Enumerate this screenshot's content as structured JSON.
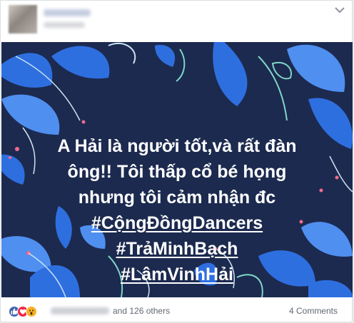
{
  "post": {
    "caption_lines": [
      "A Hải là người tốt,và rất đàn",
      "ông!! Tôi thấp cổ bé họng",
      "nhưng tôi cảm nhận đc"
    ],
    "hashtags": [
      "#CộngĐồngDancers",
      "#TrảMinhBạch",
      "#LâmVinhHải"
    ],
    "banner_colors": {
      "background": "#1c2a4f",
      "leaf_blue": "#2e6fe0",
      "leaf_light": "#4f8ff0",
      "mint": "#7fd6c8",
      "pink": "#f06a8a",
      "stem_light": "#c9e4f2"
    }
  },
  "footer": {
    "reaction_icons": [
      "like-icon",
      "love-icon",
      "wow-icon"
    ],
    "others_text": "and 126 others",
    "comments_text": "4 Comments"
  }
}
